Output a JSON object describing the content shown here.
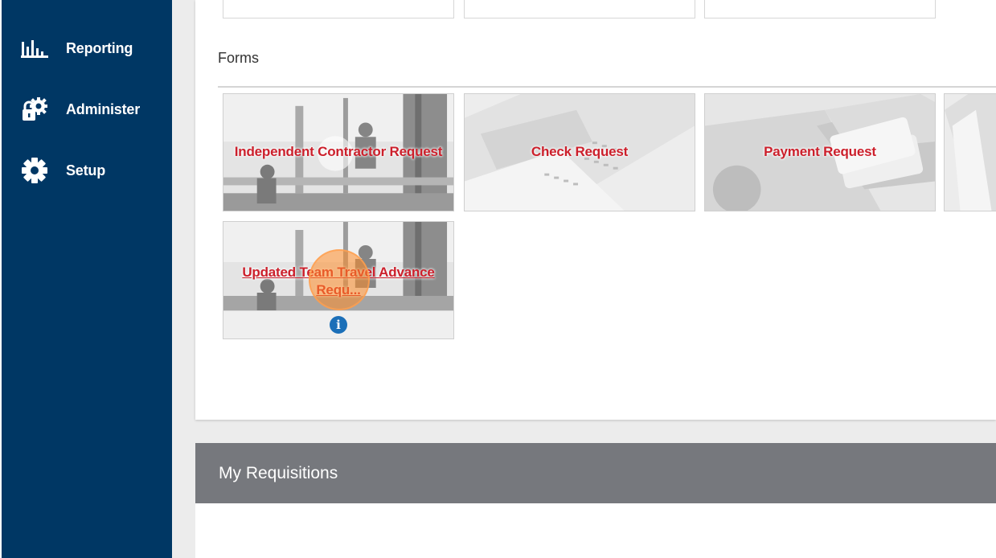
{
  "sidebar": {
    "items": [
      {
        "label": "Reporting",
        "icon": "bar-chart-icon"
      },
      {
        "label": "Administer",
        "icon": "admin-lock-gear-icon"
      },
      {
        "label": "Setup",
        "icon": "gear-icon"
      }
    ]
  },
  "forms": {
    "title": "Forms",
    "tiles": [
      {
        "label": "Independent Contractor Request"
      },
      {
        "label": "Check Request"
      },
      {
        "label": "Payment Request"
      },
      {
        "label": ""
      },
      {
        "label": "Updated Team Travel Advance Requ..."
      }
    ],
    "info_icon_glyph": "i"
  },
  "requisitions": {
    "title": "My Requisitions"
  },
  "colors": {
    "sidebar_bg": "#003764",
    "tile_label": "#cc1f2b",
    "header_gray": "#76787d",
    "info_blue": "#1b6fb8"
  }
}
